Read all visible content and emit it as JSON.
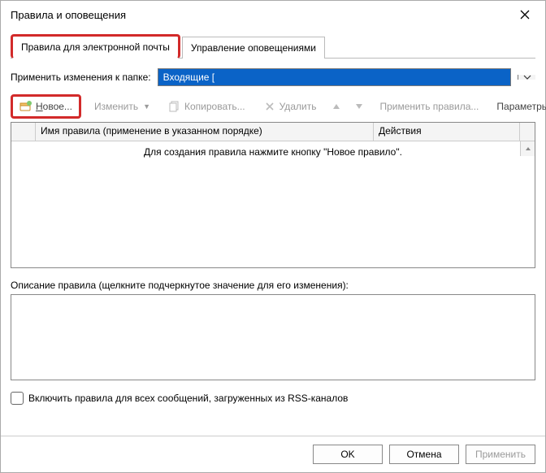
{
  "title": "Правила и оповещения",
  "tabs": {
    "email_rules": "Правила для электронной почты",
    "manage_alerts": "Управление оповещениями"
  },
  "folder": {
    "label": "Применить изменения к папке:",
    "value": "Входящие ["
  },
  "toolbar": {
    "new_label": "Новое...",
    "new_prefix_char": "Н",
    "change_label": "Изменить",
    "copy_label": "Копировать...",
    "delete_label": "Удалить",
    "run_label": "Применить правила...",
    "options_label": "Параметры"
  },
  "table": {
    "col_name": "Имя правила (применение в указанном порядке)",
    "col_actions": "Действия",
    "placeholder": "Для создания правила нажмите кнопку \"Новое правило\"."
  },
  "description": {
    "label": "Описание правила (щелкните подчеркнутое значение для его изменения):"
  },
  "rss": {
    "label": "Включить правила для всех сообщений, загруженных из RSS-каналов"
  },
  "buttons": {
    "ok": "OK",
    "cancel": "Отмена",
    "apply": "Применить"
  }
}
